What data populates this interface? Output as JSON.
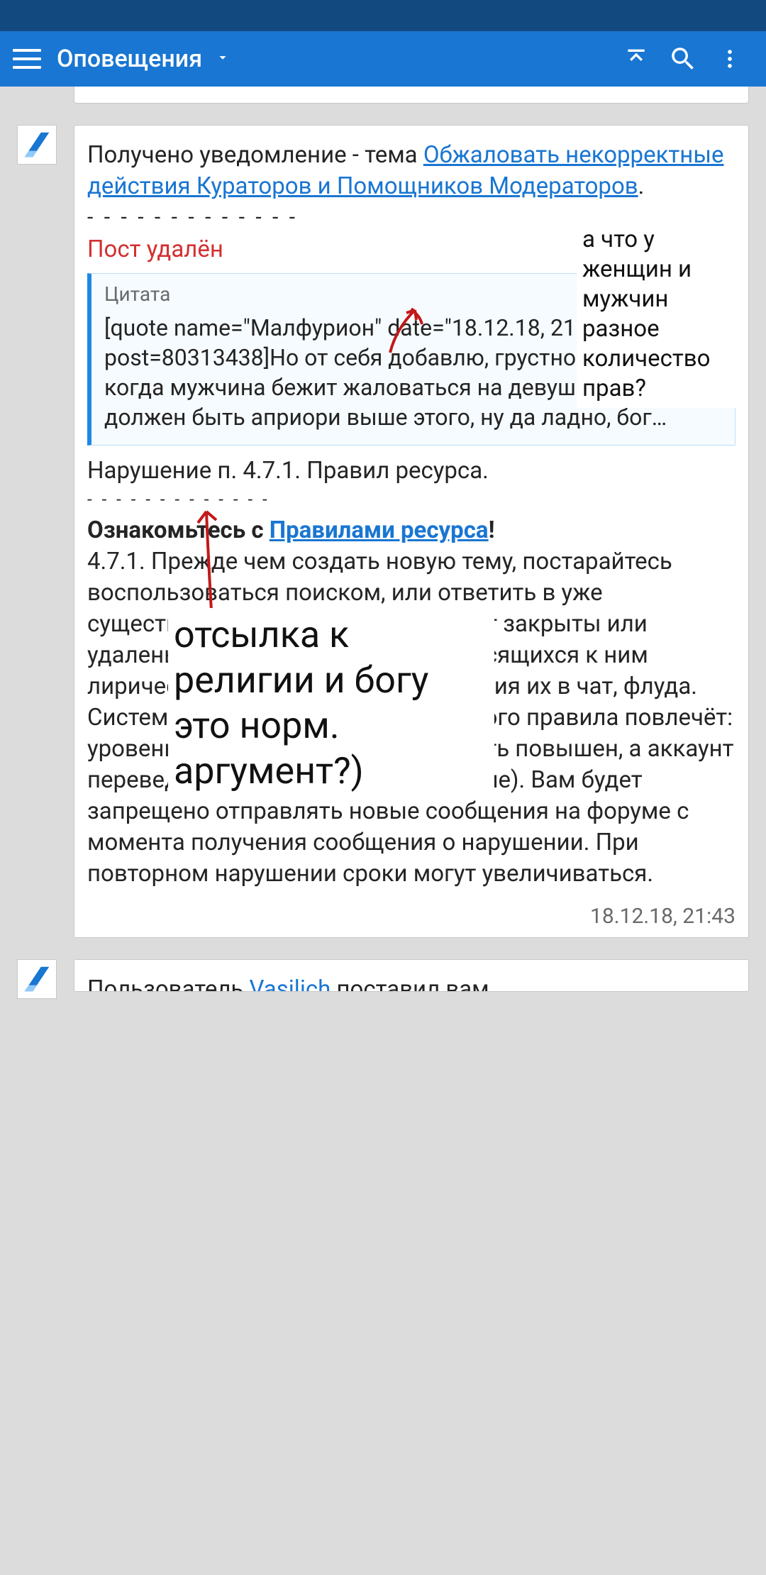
{
  "appbar": {
    "title": "Оповещения"
  },
  "card": {
    "prefix": "Получено уведомление - тема ",
    "topic_link": "Обжаловать некорректные действия Кураторов и Помощников Модераторов",
    "dot": ".",
    "dashes": "- - - - - - - - - - - - -",
    "deleted": "Пост удалён",
    "quote_header": "Цитата",
    "quote_body": "[quote name=\"Малфурион\" date=\"18.12.18, 21:10\" post=80313438]Но от себя добавлю, грустно наблюдать, когда мужчина бежит жаловаться на девушку, хотя он должен быть априори выше этого, ну да ладно, бог…",
    "violation": "Нарушение п. 4.7.1. Правил ресурса.",
    "dashes2": "- - - - - - - - - - - - -",
    "familiarize_pre": "Ознакомьтесь с ",
    "rules_link": "Правилами ресурса",
    "excl": "!",
    "body": "4.7.1. Прежде чем создать новую тему, постарайтесь воспользоваться поиском, или ответить в уже существующей. Все остальные будут закрыты или удалены. Избегайте в темах не относящихся к ним лирических отступлений, превращения их в чат, флуда. Систематическое игнорирование этого правила повлечёт: уровень предупреждений может быть повышен, а аккаунт переведен в режим RO (только чтение). Вам будет запрещено отправлять новые сообщения на форуме с момента получения сообщения о нарушении. При повторном нарушении сроки могут увеличиваться.",
    "timestamp": "18.12.18, 21:43"
  },
  "annotations": {
    "a1": "а что у женщин и мужчин разное количество прав?",
    "a2": "отсылка к религии и богу это норм. аргумент?)"
  },
  "next": {
    "prefix": "Пользователь ",
    "user": "Vasilich",
    "suffix": " поставил вам"
  }
}
